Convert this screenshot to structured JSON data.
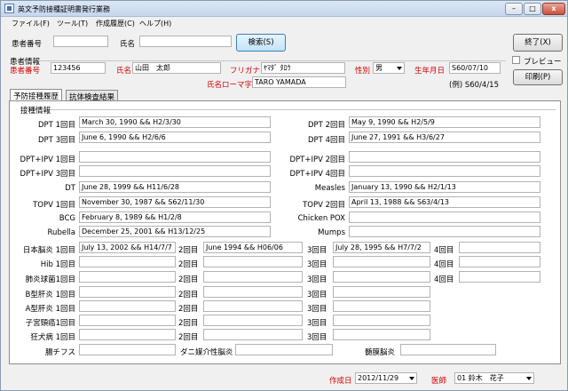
{
  "window": {
    "title": "英文予防接種証明書発行業務"
  },
  "menu": [
    "ファイル(F)",
    "ツール(T)",
    "作成履歴(C)",
    "ヘルプ(H)"
  ],
  "search": {
    "patient_no_label": "患者番号",
    "patient_no_value": "",
    "name_label": "氏名",
    "name_value": "",
    "search_button": "検索(S)"
  },
  "patient": {
    "section_label": "患者情報",
    "patient_no_label": "患者番号",
    "patient_no": "123456",
    "name_label": "氏名",
    "name": "山田　太郎",
    "furigana_label": "フリガナ",
    "furigana": "ﾔﾏﾀﾞ ﾀﾛｳ",
    "sex_label": "性別",
    "sex": "男",
    "birth_label": "生年月日",
    "birth": "S60/07/10",
    "roman_label": "氏名ローマ字",
    "roman": "TARO YAMADA",
    "birth_example": "(例) S60/4/15"
  },
  "side": {
    "exit_button": "終了(X)",
    "preview_label": "プレビュー",
    "print_button": "印刷(P)"
  },
  "tabs": [
    "予防接種履歴",
    "抗体検査結果"
  ],
  "vacc": {
    "section_label": "接種情報",
    "dpt1_label": "DPT 1回目",
    "dpt1": "March 30, 1990  &&  H2/3/30",
    "dpt2_label": "DPT 2回目",
    "dpt2": "May 9, 1990  &&  H2/5/9",
    "dpt3_label": "DPT 3回目",
    "dpt3": "June 6, 1990  &&  H2/6/6",
    "dpt4_label": "DPT 4回目",
    "dpt4": "June 27, 1991  &&  H3/6/27",
    "dptipv1_label": "DPT+IPV 1回目",
    "dptipv1": "",
    "dptipv2_label": "DPT+IPV 2回目",
    "dptipv2": "",
    "dptipv3_label": "DPT+IPV 3回目",
    "dptipv3": "",
    "dptipv4_label": "DPT+IPV 4回目",
    "dptipv4": "",
    "dt_label": "DT",
    "dt": "June 28, 1999  &&  H11/6/28",
    "measles_label": "Measles",
    "measles": "January 13, 1990  &&  H2/1/13",
    "topv1_label": "TOPV 1回目",
    "topv1": "November 30, 1987  &&  S62/11/30",
    "topv2_label": "TOPV 2回目",
    "topv2": "April 13, 1988  &&  S63/4/13",
    "bcg_label": "BCG",
    "bcg": "February 8, 1989  &&  H1/2/8",
    "chickenpox_label": "Chicken POX",
    "chickenpox": "",
    "rubella_label": "Rubella",
    "rubella": "December 25, 2001  &&  H13/12/25",
    "mumps_label": "Mumps",
    "mumps": ""
  },
  "multi": {
    "rows": [
      {
        "label": "日本脳炎 1回目",
        "d1": "July 13, 2002  &&  H14/7/7",
        "d2": "June 1994  &&  H06/06",
        "d3": "July 28, 1995  &&  H7/7/2",
        "d4": ""
      },
      {
        "label": "Hib 1回目",
        "d1": "",
        "d2": "",
        "d3": "",
        "d4": ""
      },
      {
        "label": "肺炎球菌1回目",
        "d1": "",
        "d2": "",
        "d3": "",
        "d4": ""
      },
      {
        "label": "B型肝炎 1回目",
        "d1": "",
        "d2": "",
        "d3": ""
      },
      {
        "label": "A型肝炎 1回目",
        "d1": "",
        "d2": "",
        "d3": ""
      },
      {
        "label": "子宮頸癌1回目",
        "d1": "",
        "d2": "",
        "d3": ""
      },
      {
        "label": "狂犬病 1回目",
        "d1": "",
        "d2": "",
        "d3": ""
      }
    ],
    "l2": "2回目",
    "l3": "3回目",
    "l4": "4回目",
    "typhoid_label": "腸チフス",
    "typhoid": "",
    "tick_label": "ダニ媒介性脳炎",
    "tick": "",
    "meningitis_label": "髄膜脳炎",
    "meningitis": ""
  },
  "status": {
    "created_label": "作成日",
    "created": "2012/11/29",
    "doctor_label": "医師",
    "doctor": "01 鈴木　花子"
  }
}
